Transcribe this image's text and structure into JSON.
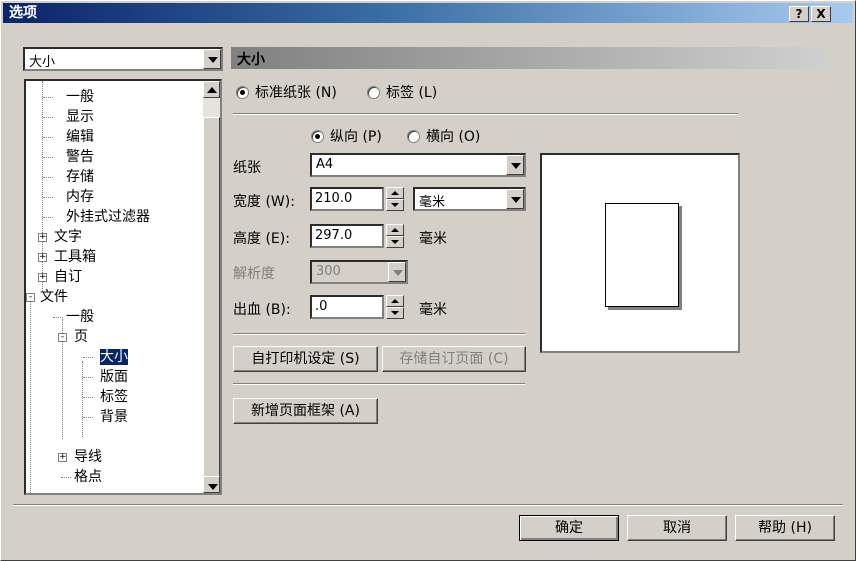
{
  "window": {
    "title": "选项",
    "help_btn": "?",
    "close_btn": "X"
  },
  "category_combo": {
    "value": "大小"
  },
  "tree": {
    "items": [
      {
        "label": "一般"
      },
      {
        "label": "显示"
      },
      {
        "label": "编辑"
      },
      {
        "label": "警告"
      },
      {
        "label": "存储"
      },
      {
        "label": "内存"
      },
      {
        "label": "外挂式过滤器"
      },
      {
        "label": "文字"
      },
      {
        "label": "工具箱"
      },
      {
        "label": "自订"
      },
      {
        "label": "文件"
      },
      {
        "label": "一般"
      },
      {
        "label": "页"
      },
      {
        "label": "大小"
      },
      {
        "label": "版面"
      },
      {
        "label": "标签"
      },
      {
        "label": "背景"
      },
      {
        "label": "导线"
      },
      {
        "label": "格点"
      }
    ],
    "expand_plus": "+",
    "expand_minus": "-"
  },
  "section": {
    "title": "大小"
  },
  "paper_type": {
    "standard_label": "标准纸张 (N)",
    "label_label": "标签 (L)"
  },
  "orientation": {
    "portrait_label": "纵向 (P)",
    "landscape_label": "横向 (O)"
  },
  "paper": {
    "label": "纸张",
    "value": "A4"
  },
  "width": {
    "label": "宽度 (W):",
    "value": "210.0",
    "unit": "毫米"
  },
  "height": {
    "label": "高度 (E):",
    "value": "297.0",
    "unit": "毫米"
  },
  "resolution": {
    "label": "解析度",
    "value": "300"
  },
  "bleed": {
    "label": "出血 (B):",
    "value": ".0",
    "unit": "毫米"
  },
  "buttons": {
    "set_from_printer": "自打印机设定 (S)",
    "save_custom": "存储自订页面 (C)",
    "add_page_frame": "新增页面框架 (A)",
    "ok": "确定",
    "cancel": "取消",
    "help": "帮助 (H)"
  },
  "colors": {
    "selection": "#0a246a",
    "titlebar": "#0a246a",
    "face": "#d4d0c8"
  }
}
